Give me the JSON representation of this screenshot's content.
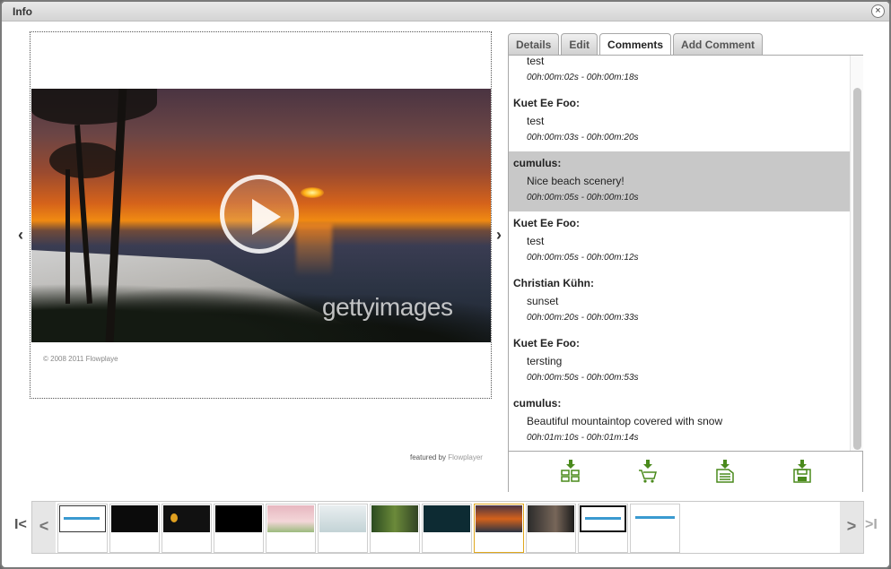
{
  "window": {
    "title": "Info",
    "close_glyph": "×"
  },
  "player": {
    "watermark_light": "getty",
    "watermark_bold": "images",
    "copyright": "© 2008  2011 Flowplaye",
    "featured_prefix": "featured by",
    "featured_link": "Flowplayer",
    "prev_glyph": "‹",
    "next_glyph": "›"
  },
  "tabs": [
    {
      "label": "Details"
    },
    {
      "label": "Edit"
    },
    {
      "label": "Comments",
      "active": true
    },
    {
      "label": "Add Comment"
    }
  ],
  "comments": [
    {
      "author": "",
      "text": "test",
      "time": "00h:00m:02s - 00h:00m:18s"
    },
    {
      "author": "Kuet Ee Foo:",
      "text": "test",
      "time": "00h:00m:03s - 00h:00m:20s"
    },
    {
      "author": "cumulus:",
      "text": "Nice beach scenery!",
      "time": "00h:00m:05s - 00h:00m:10s",
      "selected": true
    },
    {
      "author": "Kuet Ee Foo:",
      "text": "test",
      "time": "00h:00m:05s - 00h:00m:12s"
    },
    {
      "author": "Christian Kühn:",
      "text": "sunset",
      "time": "00h:00m:20s - 00h:00m:33s"
    },
    {
      "author": "Kuet Ee Foo:",
      "text": "tersting",
      "time": "00h:00m:50s - 00h:00m:53s"
    },
    {
      "author": "cumulus:",
      "text": "Beautiful mountaintop covered with snow",
      "time": "00h:01m:10s - 00h:01m:14s"
    }
  ],
  "toolbar": {
    "icons": [
      "download-grid-icon",
      "download-cart-icon",
      "download-document-icon",
      "download-save-icon"
    ],
    "accent": "#4a8a1c"
  },
  "filmstrip": {
    "first_glyph": "I<",
    "last_glyph": ">I",
    "prev_glyph": "<",
    "next_glyph": ">",
    "selected_index": 8,
    "selected_color": "#e0a81e"
  }
}
